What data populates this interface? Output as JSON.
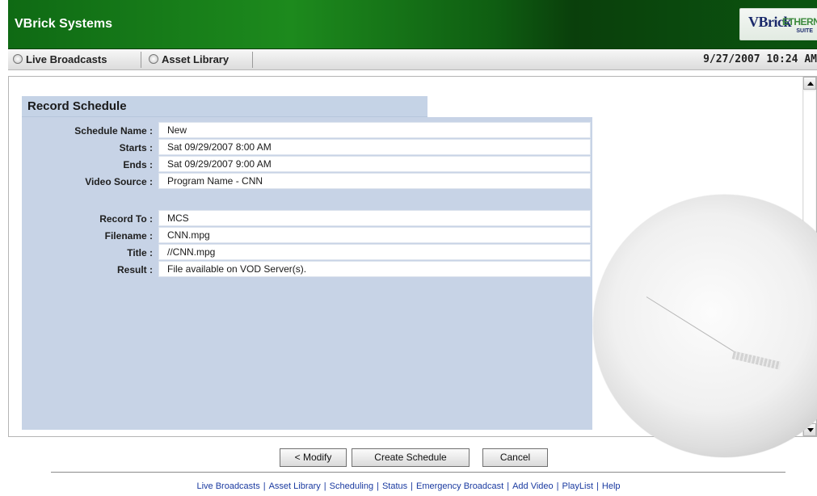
{
  "app": {
    "title": "VBrick Systems",
    "logo": {
      "main": "VBrick",
      "sub": "ETHERNETV",
      "suite": "SUITE"
    }
  },
  "nav": {
    "tabs": [
      {
        "label": "Live Broadcasts"
      },
      {
        "label": "Asset Library"
      }
    ],
    "datetime": "9/27/2007 10:24 AM"
  },
  "record_schedule": {
    "title": "Record Schedule",
    "fields": [
      {
        "label": "Schedule Name :",
        "value": "New"
      },
      {
        "label": "Starts :",
        "value": "Sat 09/29/2007 8:00 AM"
      },
      {
        "label": "Ends :",
        "value": "Sat 09/29/2007 9:00 AM"
      },
      {
        "label": "Video Source :",
        "value": "Program Name - CNN"
      },
      {
        "label": "Record To :",
        "value": "MCS"
      },
      {
        "label": "Filename :",
        "value": "CNN.mpg"
      },
      {
        "label": "Title :",
        "value": "//CNN.mpg"
      },
      {
        "label": "Result :",
        "value": "File available on VOD Server(s)."
      }
    ]
  },
  "buttons": {
    "modify": "< Modify",
    "create": "Create Schedule",
    "cancel": "Cancel"
  },
  "footer": {
    "links": [
      "Live Broadcasts",
      "Asset Library",
      "Scheduling",
      "Status",
      "Emergency Broadcast",
      "Add Video",
      "PlayList",
      "Help"
    ]
  },
  "colors": {
    "brand_green": "#1d8a1d",
    "panel_blue": "#c7d3e6",
    "link_blue": "#1a3aa0"
  }
}
